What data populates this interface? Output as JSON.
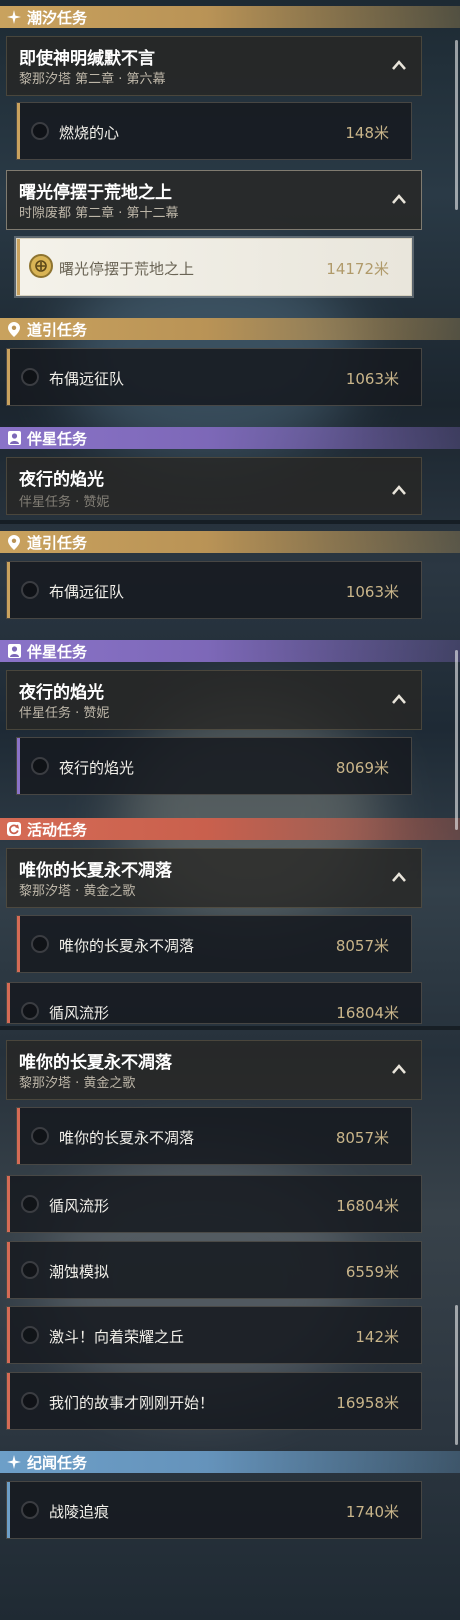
{
  "screenshot_1": {
    "bar_tide": "潮汐任务",
    "quest_a_title": "即使神明缄默不言",
    "quest_a_sub": "黎那汐塔 第二章 · 第六幕",
    "row_a1_name": "燃烧的心",
    "row_a1_dist": "148米",
    "quest_b_title": "曙光停摆于荒地之上",
    "quest_b_sub": "时隙废都 第二章 · 第十二幕",
    "row_b1_name": "曙光停摆于荒地之上",
    "row_b1_dist": "14172米",
    "bar_guide": "道引任务",
    "row_guide_name": "布偶远征队",
    "row_guide_dist": "1063米",
    "bar_companion": "伴星任务",
    "quest_c_title": "夜行的焰光",
    "quest_c_sub": "伴星任务 · 赞妮"
  },
  "screenshot_2": {
    "bar_guide": "道引任务",
    "row_guide_name": "布偶远征队",
    "row_guide_dist": "1063米",
    "bar_companion": "伴星任务",
    "quest_c_title": "夜行的焰光",
    "quest_c_sub": "伴星任务 · 赞妮",
    "row_c1_name": "夜行的焰光",
    "row_c1_dist": "8069米",
    "bar_event": "活动任务",
    "quest_d_title": "唯你的长夏永不凋落",
    "quest_d_sub": "黎那汐塔 · 黄金之歌",
    "row_d1_name": "唯你的长夏永不凋落",
    "row_d1_dist": "8057米",
    "row_d2_name": "循风流形",
    "row_d2_dist": "16804米"
  },
  "screenshot_3": {
    "quest_d_title": "唯你的长夏永不凋落",
    "quest_d_sub": "黎那汐塔 · 黄金之歌",
    "row_d1_name": "唯你的长夏永不凋落",
    "row_d1_dist": "8057米",
    "row_d2_name": "循风流形",
    "row_d2_dist": "16804米",
    "row_d3_name": "潮蚀模拟",
    "row_d3_dist": "6559米",
    "row_d4_name": "激斗！向着荣耀之丘",
    "row_d4_dist": "142米",
    "row_d5_name": "我们的故事才刚刚开始！",
    "row_d5_dist": "16958米",
    "bar_record": "纪闻任务",
    "row_record_name": "战陵追痕",
    "row_record_dist": "1740米"
  },
  "colors": {
    "tide_bar": "#c9a25e",
    "companion_bar": "#8a73c8",
    "event_bar": "#d56b55",
    "record_bar": "#6d9fc8",
    "distance_text": "#c9b58a"
  },
  "icons": {
    "tide": "sparkle-icon",
    "guide": "map-pin-icon",
    "companion": "person-icon",
    "event": "refresh-icon",
    "record": "sparkle-icon",
    "expand": "chevron-up-icon",
    "status": "circle-icon",
    "tracked": "crosshair-target-icon"
  }
}
